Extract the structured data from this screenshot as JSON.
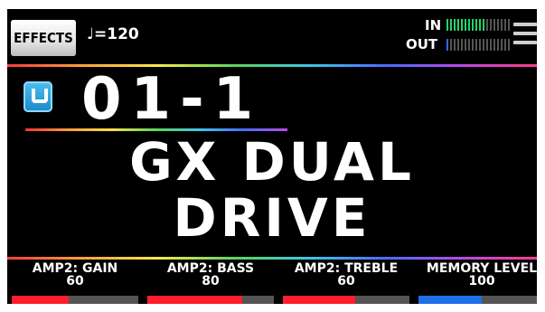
{
  "header": {
    "effects_label": "EFFECTS",
    "tempo_text": "♩=120",
    "in_label": "IN",
    "out_label": "OUT",
    "in_level": 0.6,
    "out_level": 0.05
  },
  "patch": {
    "bank_icon": "user-icon",
    "number": "01-1",
    "name_line1": "GX DUAL",
    "name_line2": "DRIVE"
  },
  "knobs": [
    {
      "label": "AMP2: GAIN",
      "value": "60",
      "level": 0.45,
      "color": "#ff1e2d"
    },
    {
      "label": "AMP2: BASS",
      "value": "80",
      "level": 0.75,
      "color": "#ff1e2d"
    },
    {
      "label": "AMP2: TREBLE",
      "value": "60",
      "level": 0.57,
      "color": "#ff1e2d"
    },
    {
      "label": "MEMORY LEVEL",
      "value": "100",
      "level": 0.5,
      "color": "#1f6fe8"
    }
  ],
  "colors": {
    "background": "#000000",
    "in_meter": "#22d36a",
    "out_meter": "#2b6bff",
    "meter_off": "#555555"
  }
}
